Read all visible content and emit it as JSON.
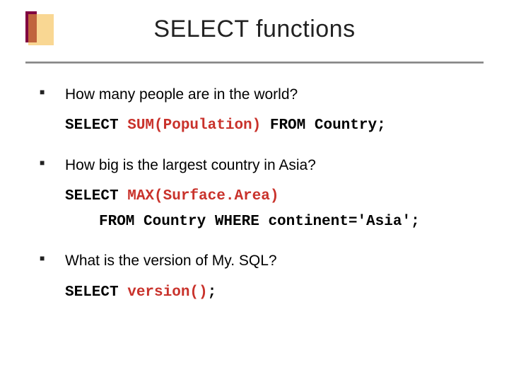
{
  "title": "SELECT functions",
  "bullets": [
    {
      "question": "How many people are in the world?",
      "code_lines": [
        {
          "pre": "SELECT ",
          "fn": "SUM(Population)",
          "post": " FROM Country;"
        }
      ]
    },
    {
      "question": "How big is the largest country in Asia?",
      "code_lines": [
        {
          "pre": "SELECT ",
          "fn": "MAX(Surface.Area)",
          "post": ""
        },
        {
          "pre": "FROM Country WHERE continent='Asia';",
          "fn": "",
          "post": "",
          "indent": true
        }
      ]
    },
    {
      "question": "What is the version of My. SQL?",
      "code_lines": [
        {
          "pre": "SELECT ",
          "fn": "version()",
          "post": ";"
        }
      ]
    }
  ]
}
